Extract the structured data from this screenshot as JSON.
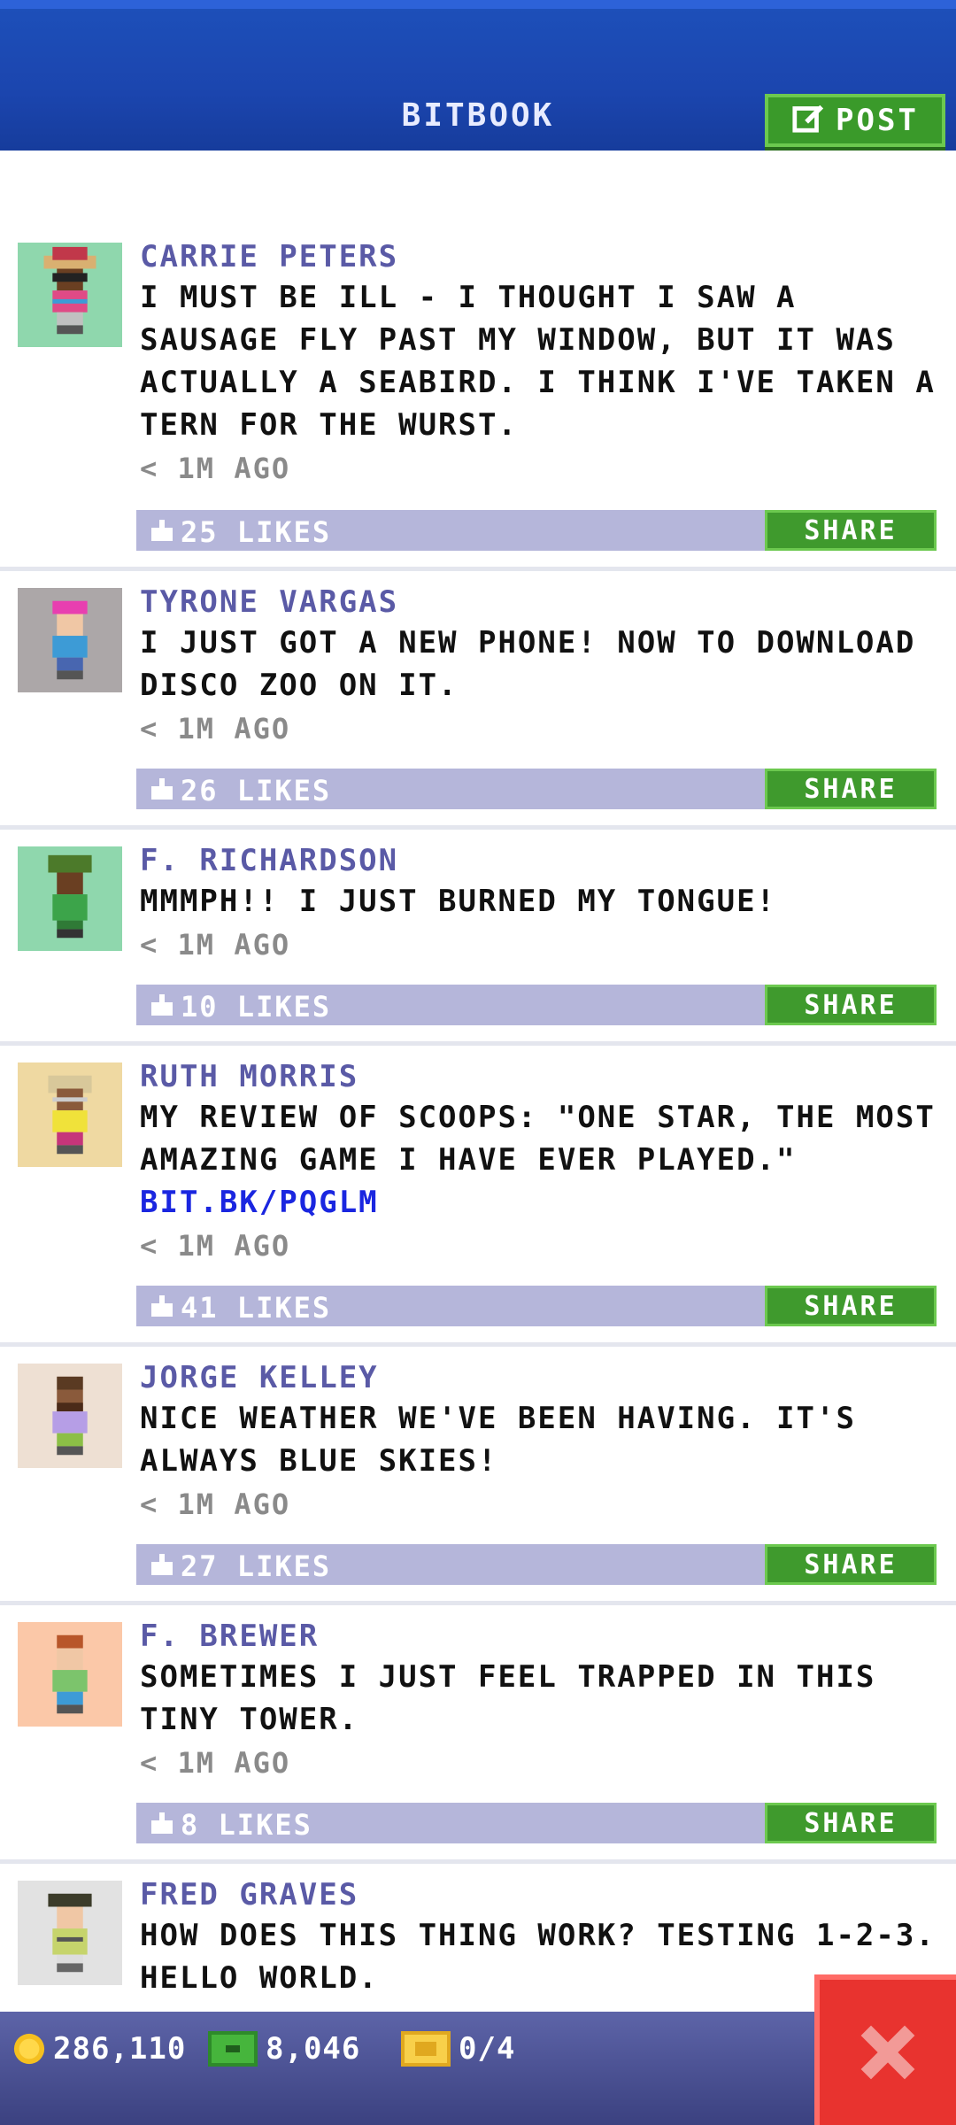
{
  "header": {
    "title": "BITBOOK",
    "post_label": "POST"
  },
  "posts": [
    {
      "author": "CARRIE PETERS",
      "message": "I MUST BE ILL - I THOUGHT I SAW A SAUSAGE FLY PAST MY WINDOW, BUT IT WAS ACTUALLY A SEABIRD. I THINK I'VE TAKEN A TERN FOR THE WURST.",
      "link": "",
      "time": "< 1M AGO",
      "likes": "25 LIKES",
      "share": "SHARE"
    },
    {
      "author": "TYRONE VARGAS",
      "message": "I JUST GOT A NEW PHONE! NOW TO DOWNLOAD DISCO ZOO ON IT.",
      "link": "",
      "time": "< 1M AGO",
      "likes": "26 LIKES",
      "share": "SHARE"
    },
    {
      "author": "F. RICHARDSON",
      "message": "MMMPH!! I JUST BURNED MY TONGUE!",
      "link": "",
      "time": "< 1M AGO",
      "likes": "10 LIKES",
      "share": "SHARE"
    },
    {
      "author": "RUTH MORRIS",
      "message": "MY REVIEW OF SCOOPS: \"ONE STAR, THE MOST AMAZING GAME I HAVE EVER PLAYED.\"",
      "link": "BIT.BK/PQGLM",
      "time": "< 1M AGO",
      "likes": "41 LIKES",
      "share": "SHARE"
    },
    {
      "author": "JORGE KELLEY",
      "message": "NICE WEATHER WE'VE BEEN HAVING. IT'S ALWAYS BLUE SKIES!",
      "link": "",
      "time": "< 1M AGO",
      "likes": "27 LIKES",
      "share": "SHARE"
    },
    {
      "author": "F. BREWER",
      "message": "SOMETIMES I JUST FEEL TRAPPED IN THIS TINY TOWER.",
      "link": "",
      "time": "< 1M AGO",
      "likes": "8 LIKES",
      "share": "SHARE"
    },
    {
      "author": "FRED GRAVES",
      "message": "HOW DOES THIS THING WORK? TESTING 1-2-3. HELLO WORLD.",
      "link": "",
      "time": "",
      "likes": "",
      "share": ""
    }
  ],
  "footer": {
    "coins": "286,110",
    "bux": "8,046",
    "tickets": "0/4"
  },
  "icons": {
    "post": "edit-icon",
    "like": "thumbs-up-icon",
    "coin": "coin-icon",
    "bux": "bux-icon",
    "ticket": "ticket-icon",
    "close": "close-icon"
  },
  "colors": {
    "header": "#1b45ae",
    "green": "#3f9a2d",
    "likes_bar": "#b5b6da",
    "author": "#5a5aa6",
    "close": "#e8332f"
  }
}
